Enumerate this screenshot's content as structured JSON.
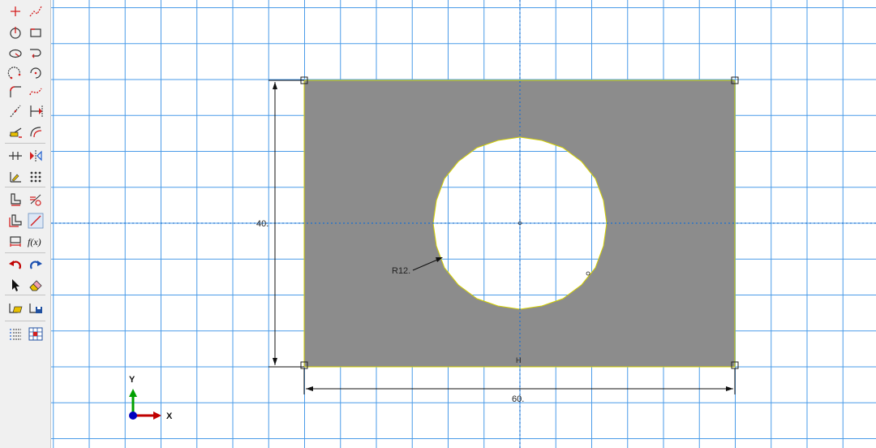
{
  "viewport": {
    "dimensions": {
      "height_value": "40.",
      "width_value": "60.",
      "radius_value": "R12."
    },
    "constraint_marker": "H",
    "triad": {
      "x_label": "X",
      "y_label": "Y"
    }
  },
  "toolbox": {
    "rows": [
      [
        "create-point-icon",
        "create-polyline-icon"
      ],
      [
        "create-circle-icon",
        "create-rectangle-icon"
      ],
      [
        "create-ellipse-icon",
        "create-arc-tangent-icon"
      ],
      [
        "create-arc-three-points-icon",
        "create-arc-center-icon"
      ],
      [
        "create-fillet-icon",
        "create-spline-icon"
      ],
      [
        "construction-line-icon",
        "dimension-icon"
      ],
      [
        "auto-trim-icon",
        "offset-curve-icon"
      ],
      [
        "add-constraint-icon",
        "mirror-icon"
      ],
      [
        "sketch-options-icon",
        "array-pattern-icon"
      ],
      [
        "edit-dimension-icon",
        "parameter-manager-icon"
      ],
      [
        "edit-geometry-icon",
        "edit-dimension-value-icon"
      ],
      [
        "transform-icon",
        "function-fx-icon"
      ],
      [
        "undo-icon",
        "redo-icon"
      ],
      [
        "select-arrow-icon",
        "eraser-icon"
      ],
      [
        "open-sketch-icon",
        "save-sketch-icon"
      ],
      [
        "sketch-list-icon",
        "grid-settings-icon"
      ]
    ],
    "function_label": "f(x)"
  },
  "colors": {
    "grid": "#4a9be8",
    "gray_fill": "#8c8c8c",
    "outline": "#d4d000",
    "dimension": "#111111",
    "axis_x": "#c00000",
    "axis_y": "#00a000",
    "axis_z": "#0000c0",
    "sketch_red": "#d42020"
  }
}
